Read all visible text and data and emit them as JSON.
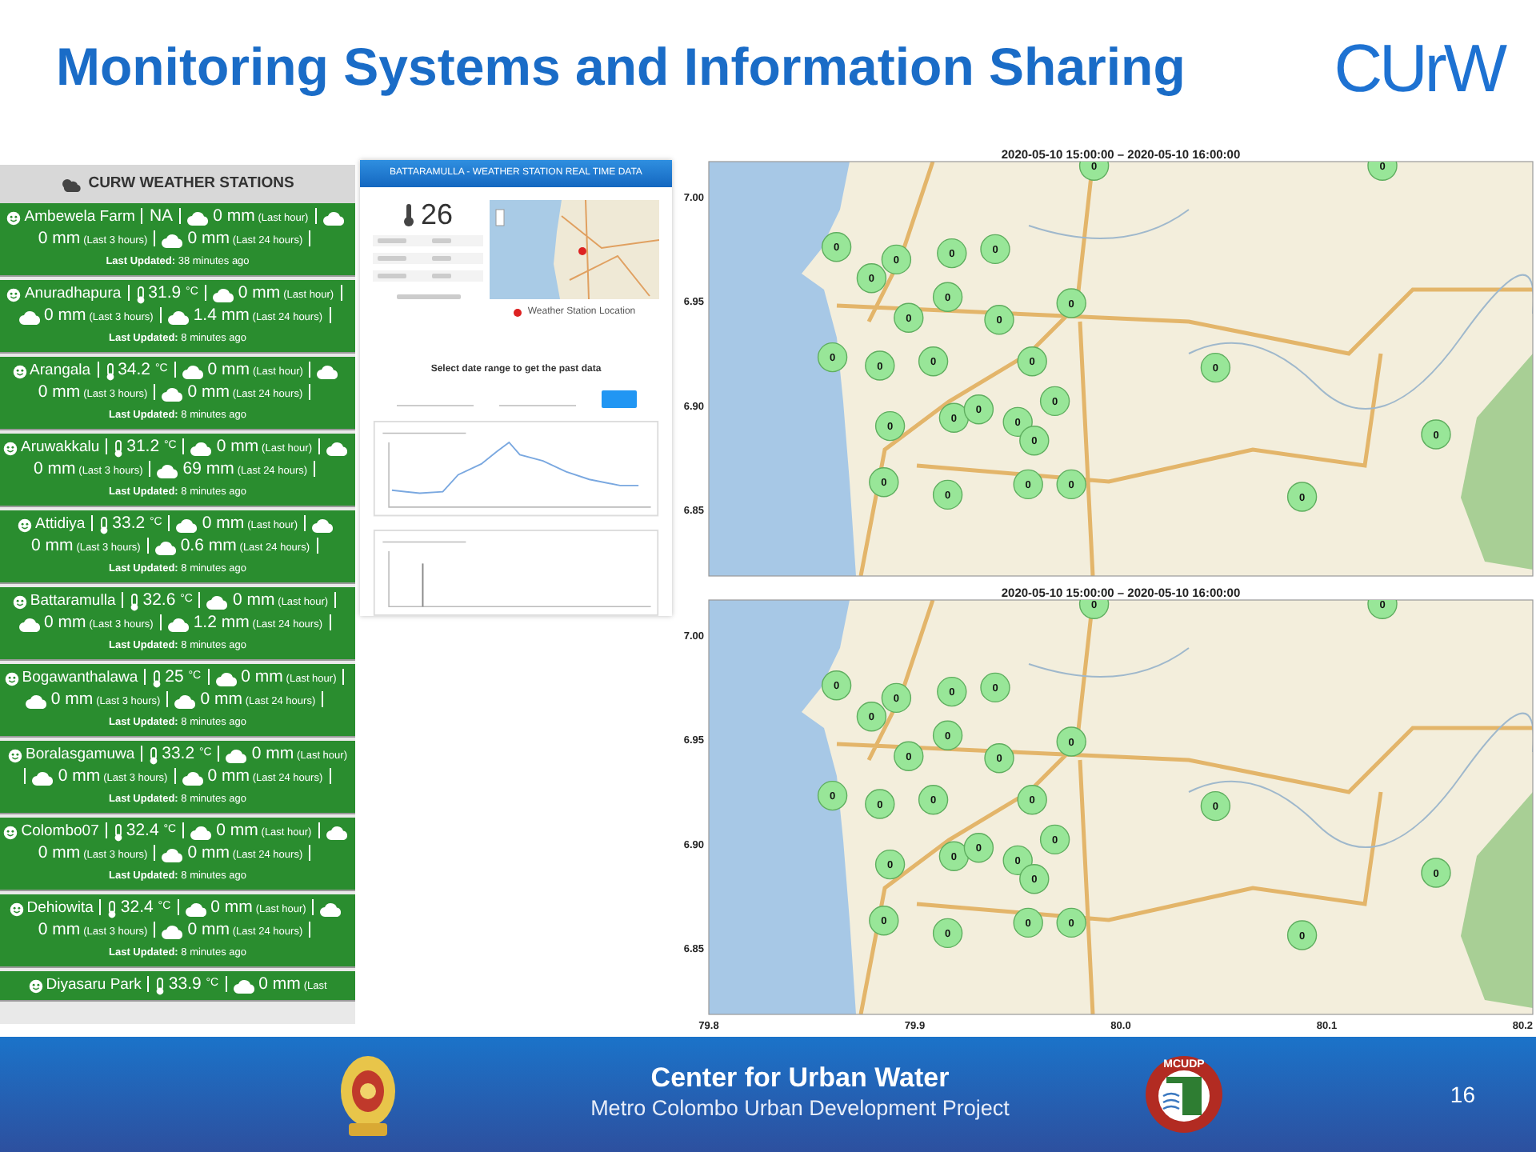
{
  "slide": {
    "title": "Monitoring Systems and Information Sharing",
    "logo": "CUrW",
    "page_number": "16"
  },
  "stations_panel": {
    "header": "CURW WEATHER STATIONS",
    "stations": [
      {
        "name": "Ambewela Farm",
        "thermometer": false,
        "temperature": "NA",
        "rain": [
          {
            "amount": "0 mm",
            "period": "(Last hour)"
          },
          {
            "amount": "0 mm",
            "period": "(Last 3 hours)"
          },
          {
            "amount": "0 mm",
            "period": "(Last 24 hours)"
          }
        ],
        "updated": "**Last Updated:** 38 minutes ago"
      },
      {
        "name": "Anuradhapura",
        "thermometer": true,
        "temperature": "31.9 $^{°C}$",
        "rain": [
          {
            "amount": "0 mm",
            "period": "(Last hour)"
          },
          {
            "amount": "0 mm",
            "period": "(Last 3 hours)"
          },
          {
            "amount": "1.4 mm",
            "period": "(Last 24 hours)"
          }
        ],
        "updated": "**Last Updated:** 8 minutes ago"
      },
      {
        "name": "Arangala",
        "thermometer": true,
        "temperature": "34.2 $^{°C}$",
        "rain": [
          {
            "amount": "0 mm",
            "period": "(Last hour)"
          },
          {
            "amount": "0 mm",
            "period": "(Last 3 hours)"
          },
          {
            "amount": "0 mm",
            "period": "(Last 24 hours)"
          }
        ],
        "updated": "**Last Updated:** 8 minutes ago"
      },
      {
        "name": "Aruwakkalu",
        "thermometer": true,
        "temperature": "31.2 $^{°C}$",
        "rain": [
          {
            "amount": "0 mm",
            "period": "(Last hour)"
          },
          {
            "amount": "0 mm",
            "period": "(Last 3 hours)"
          },
          {
            "amount": "69 mm",
            "period": "(Last 24 hours)"
          }
        ],
        "updated": "**Last Updated:** 8 minutes ago"
      },
      {
        "name": "Attidiya",
        "thermometer": true,
        "temperature": "33.2 $^{°C}$",
        "rain": [
          {
            "amount": "0 mm",
            "period": "(Last hour)"
          },
          {
            "amount": "0 mm",
            "period": "(Last 3 hours)"
          },
          {
            "amount": "0.6 mm",
            "period": "(Last 24 hours)"
          }
        ],
        "updated": "**Last Updated:** 8 minutes ago"
      },
      {
        "name": "Battaramulla",
        "thermometer": true,
        "temperature": "32.6 $^{°C}$",
        "rain": [
          {
            "amount": "0 mm",
            "period": "(Last hour)"
          },
          {
            "amount": "0 mm",
            "period": "(Last 3 hours)"
          },
          {
            "amount": "1.2 mm",
            "period": "(Last 24 hours)"
          }
        ],
        "updated": "**Last Updated:** 8 minutes ago"
      },
      {
        "name": "Bogawanthalawa",
        "thermometer": true,
        "temperature": "25 $^{°C}$",
        "rain": [
          {
            "amount": "0 mm",
            "period": "(Last hour)"
          },
          {
            "amount": "0 mm",
            "period": "(Last 3 hours)"
          },
          {
            "amount": "0 mm",
            "period": "(Last 24 hours)"
          }
        ],
        "updated": "**Last Updated:** 8 minutes ago"
      },
      {
        "name": "Boralasgamuwa",
        "thermometer": true,
        "temperature": "33.2 $^{°C}$",
        "rain": [
          {
            "amount": "0 mm",
            "period": "(Last hour)"
          },
          {
            "amount": "0 mm",
            "period": "(Last 3 hours)"
          },
          {
            "amount": "0 mm",
            "period": "(Last 24 hours)"
          }
        ],
        "updated": "**Last Updated:** 8 minutes ago"
      },
      {
        "name": "Colombo07",
        "thermometer": true,
        "temperature": "32.4 $^{°C}$",
        "rain": [
          {
            "amount": "0 mm",
            "period": "(Last hour)"
          },
          {
            "amount": "0 mm",
            "period": "(Last 3 hours)"
          },
          {
            "amount": "0 mm",
            "period": "(Last 24 hours)"
          }
        ],
        "updated": "**Last Updated:** 8 minutes ago"
      },
      {
        "name": "Dehiowita",
        "thermometer": true,
        "temperature": "32.4 $^{°C}$",
        "rain": [
          {
            "amount": "0 mm",
            "period": "(Last hour)"
          },
          {
            "amount": "0 mm",
            "period": "(Last 3 hours)"
          },
          {
            "amount": "0 mm",
            "period": "(Last 24 hours)"
          }
        ],
        "updated": "**Last Updated:** 8 minutes ago"
      },
      {
        "name": "Diyasaru Park",
        "thermometer": true,
        "temperature": "33.9 $^{°C}$",
        "rain": [
          {
            "amount": "0 mm",
            "period": "(Last"
          }
        ]
      }
    ]
  },
  "realtime_page": {
    "header": "BATTARAMULLA - WEATHER STATION REAL TIME DATA",
    "temperature": "26",
    "map_legend": "Weather Station Location",
    "date_range_prompt": "Select date range to get the past data"
  },
  "maps": [
    {
      "chart_data": {
        "type": "scatter",
        "title": "2020-05-10 15:00:00 – 2020-05-10 16:00:00",
        "x": [
          79.987,
          80.127,
          79.862,
          79.891,
          79.918,
          79.939,
          79.879,
          79.916,
          79.976,
          79.897,
          79.941,
          79.86,
          79.883,
          79.909,
          79.957,
          80.046,
          79.968,
          79.919,
          79.931,
          79.888,
          79.95,
          79.958,
          80.153,
          79.885,
          79.916,
          79.955,
          79.976,
          80.088
        ],
        "series": [
          {
            "color": "#98e698",
            "values": [
              7.015,
              7.015,
              6.976,
              6.97,
              6.973,
              6.975,
              6.961,
              6.952,
              6.949,
              6.942,
              6.941,
              6.923,
              6.919,
              6.921,
              6.921,
              6.918,
              6.902,
              6.894,
              6.898,
              6.89,
              6.892,
              6.883,
              6.886,
              6.863,
              6.857,
              6.862,
              6.862,
              6.856
            ]
          }
        ],
        "value_labels": [
          "0",
          "0",
          "0",
          "0",
          "0",
          "0",
          "0",
          "0",
          "0",
          "0",
          "0",
          "0",
          "0",
          "0",
          "0",
          "0",
          "0",
          "0",
          "0",
          "0",
          "0",
          "0",
          "0",
          "0",
          "0",
          "0",
          "0",
          "0"
        ],
        "xlim": [
          79.8,
          80.2
        ],
        "ylim": [
          6.818,
          7.017
        ],
        "yticks": [
          {
            "value": 7.0,
            "label": "7.00"
          },
          {
            "value": 6.95,
            "label": "6.95"
          },
          {
            "value": 6.9,
            "label": "6.90"
          },
          {
            "value": 6.85,
            "label": "6.85"
          }
        ]
      }
    },
    {
      "chart_data": {
        "type": "scatter",
        "title": "2020-05-10 15:00:00 – 2020-05-10 16:00:00",
        "x": [
          79.987,
          80.127,
          79.862,
          79.891,
          79.918,
          79.939,
          79.879,
          79.916,
          79.976,
          79.897,
          79.941,
          79.86,
          79.883,
          79.909,
          79.957,
          80.046,
          79.968,
          79.919,
          79.931,
          79.888,
          79.95,
          79.958,
          80.153,
          79.885,
          79.916,
          79.955,
          79.976,
          80.088
        ],
        "series": [
          {
            "color": "#98e698",
            "values": [
              7.015,
              7.015,
              6.976,
              6.97,
              6.973,
              6.975,
              6.961,
              6.952,
              6.949,
              6.942,
              6.941,
              6.923,
              6.919,
              6.921,
              6.921,
              6.918,
              6.902,
              6.894,
              6.898,
              6.89,
              6.892,
              6.883,
              6.886,
              6.863,
              6.857,
              6.862,
              6.862,
              6.856
            ]
          }
        ],
        "value_labels": [
          "0",
          "0",
          "0",
          "0",
          "0",
          "0",
          "0",
          "0",
          "0",
          "0",
          "0",
          "0",
          "0",
          "0",
          "0",
          "0",
          "0",
          "0",
          "0",
          "0",
          "0",
          "0",
          "0",
          "0",
          "0",
          "0",
          "0",
          "0"
        ],
        "xlim": [
          79.8,
          80.2
        ],
        "ylim": [
          6.818,
          7.017
        ],
        "xticks": [
          {
            "value": 79.8,
            "label": "79.8"
          },
          {
            "value": 79.9,
            "label": "79.9"
          },
          {
            "value": 80.0,
            "label": "80.0"
          },
          {
            "value": 80.1,
            "label": "80.1"
          },
          {
            "value": 80.2,
            "label": "80.2"
          }
        ],
        "yticks": [
          {
            "value": 7.0,
            "label": "7.00"
          },
          {
            "value": 6.95,
            "label": "6.95"
          },
          {
            "value": 6.9,
            "label": "6.90"
          },
          {
            "value": 6.85,
            "label": "6.85"
          }
        ]
      }
    }
  ],
  "footer": {
    "title": "Center for Urban Water",
    "subtitle": "Metro Colombo Urban Development Project",
    "logo_text": "MCUDP"
  }
}
